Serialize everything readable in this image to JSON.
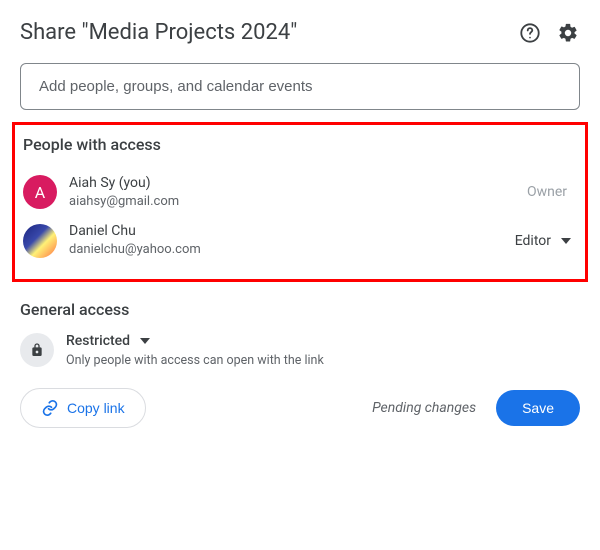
{
  "header": {
    "title": "Share \"Media Projects 2024\""
  },
  "addInput": {
    "placeholder": "Add people, groups, and calendar events"
  },
  "peopleSection": {
    "title": "People with access",
    "people": [
      {
        "initial": "A",
        "name": "Aiah Sy (you)",
        "email": "aiahsy@gmail.com",
        "role": "Owner",
        "roleEditable": false
      },
      {
        "initial": "",
        "name": "Daniel Chu",
        "email": "danielchu@yahoo.com",
        "role": "Editor",
        "roleEditable": true
      }
    ]
  },
  "generalSection": {
    "title": "General access",
    "mode": "Restricted",
    "description": "Only people with access can open with the link"
  },
  "footer": {
    "copyLink": "Copy link",
    "pending": "Pending changes",
    "save": "Save"
  }
}
